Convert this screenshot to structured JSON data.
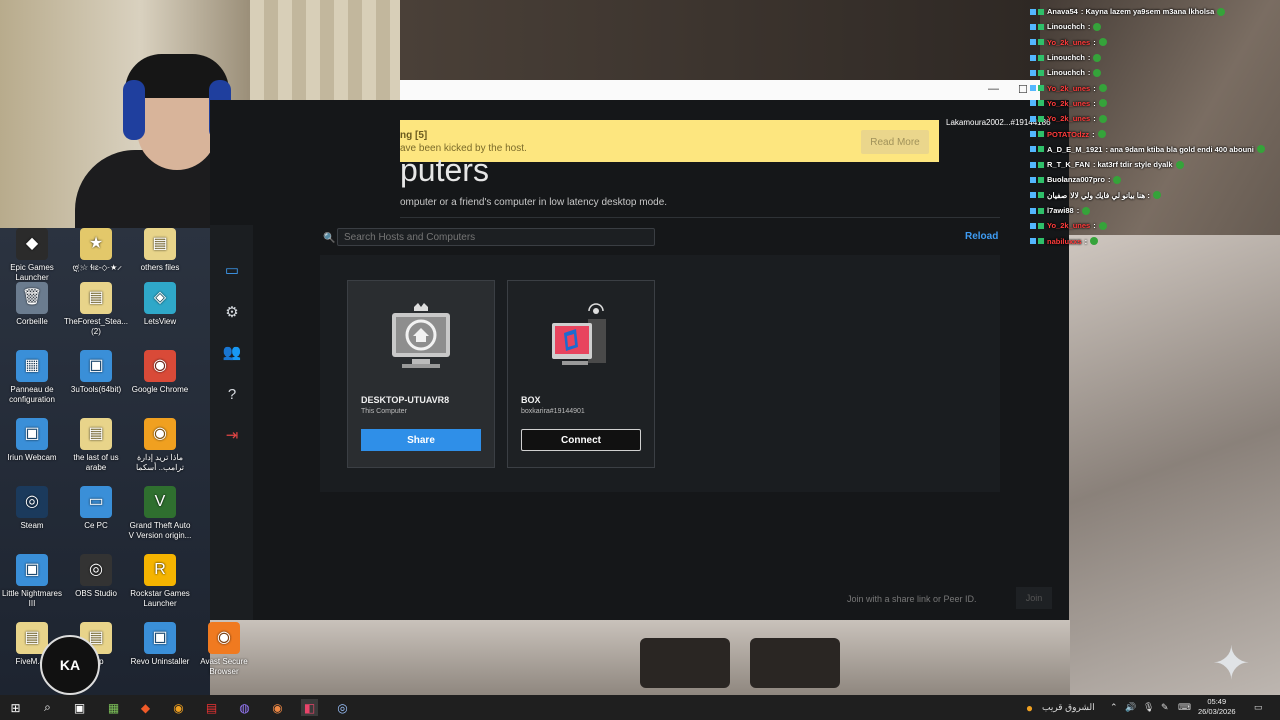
{
  "desktop": {
    "icons": [
      {
        "label": "Epic Games Launcher",
        "glyph": "◆",
        "color": "#2b2b2b"
      },
      {
        "label": "ღ҉ ☆ ɬıɛ-◇·★ ̷",
        "glyph": "★",
        "color": "#e3c86a"
      },
      {
        "label": "others files",
        "glyph": "▤",
        "color": "#e8d48a"
      },
      {
        "label": "Corbeille",
        "glyph": "🗑",
        "color": "#6b7c8f"
      },
      {
        "label": "TheForest_Stea... (2)",
        "glyph": "▤",
        "color": "#e8d48a"
      },
      {
        "label": "LetsView",
        "glyph": "◈",
        "color": "#2fa8c9"
      },
      {
        "label": "Panneau de configuration",
        "glyph": "▦",
        "color": "#3a8fd8"
      },
      {
        "label": "3uTools(64bit)",
        "glyph": "▣",
        "color": "#3a8fd8"
      },
      {
        "label": "Google Chrome",
        "glyph": "◉",
        "color": "#d94a38"
      },
      {
        "label": "Iriun Webcam",
        "glyph": "▣",
        "color": "#3a8fd8"
      },
      {
        "label": "the last of us arabe",
        "glyph": "▤",
        "color": "#e8d48a"
      },
      {
        "label": "ماذا تريد إدارة ترامب.. أسكما",
        "glyph": "◉",
        "color": "#f0a020"
      },
      {
        "label": "Steam",
        "glyph": "◎",
        "color": "#1b3a5c"
      },
      {
        "label": "Ce PC",
        "glyph": "▭",
        "color": "#3a8fd8"
      },
      {
        "label": "Grand Theft Auto V Version origin...",
        "glyph": "V",
        "color": "#2f6f2f"
      },
      {
        "label": "Little Nightmares III",
        "glyph": "▣",
        "color": "#3a8fd8"
      },
      {
        "label": "OBS Studio",
        "glyph": "◎",
        "color": "#333"
      },
      {
        "label": "Rockstar Games Launcher",
        "glyph": "R",
        "color": "#f5b400"
      },
      {
        "label": "FiveM.ap",
        "glyph": "▤",
        "color": "#e8d48a"
      },
      {
        "label": "y up",
        "glyph": "▤",
        "color": "#e8d48a"
      },
      {
        "label": "Revo Uninstaller",
        "glyph": "▣",
        "color": "#3a8fd8"
      },
      {
        "label": "Avast Secure Browser",
        "glyph": "◉",
        "color": "#f07a20"
      }
    ],
    "badge": "KA"
  },
  "app": {
    "banner": {
      "title": "ng [5]",
      "message": "ave been kicked by the host.",
      "read_more": "Read More"
    },
    "user_tag": "Lakamoura2002...#19144186",
    "page_title": "puters",
    "page_subtitle": "omputer or a friend's computer in low latency desktop mode.",
    "search_placeholder": "Search Hosts and Computers",
    "reload_label": "Reload",
    "cards": [
      {
        "name": "DESKTOP-UTUAVR8",
        "subtitle": "This Computer",
        "button": "Share"
      },
      {
        "name": "BOX",
        "subtitle": "boxkarira#19144901",
        "button": "Connect"
      }
    ],
    "join_label": "Join with a share link or Peer ID.",
    "join_button": "Join"
  },
  "chat": [
    {
      "user": "Anava54",
      "text": ": Kayna lazem ya9sem m3ana lkholsa",
      "color": "#e0e0e0"
    },
    {
      "user": "Linouchch",
      "text": ":",
      "color": "#e0e0e0"
    },
    {
      "user": "Yo_2k_unes",
      "text": ":",
      "color": "#ff3b3b"
    },
    {
      "user": "Linouchch",
      "text": ":",
      "color": "#e0e0e0"
    },
    {
      "user": "Linouchch",
      "text": ":",
      "color": "#e0e0e0"
    },
    {
      "user": "Yo_2k_unes",
      "text": ":",
      "color": "#ff3b3b"
    },
    {
      "user": "Yo_2k_unes",
      "text": ":",
      "color": "#ff3b3b"
    },
    {
      "user": "Yo_2k_unes",
      "text": ":",
      "color": "#ff3b3b"
    },
    {
      "user": "POTATOdzz",
      "text": ":",
      "color": "#ff3b3b"
    },
    {
      "user": "A_D_E_M_1921",
      "text": ": ana 9dam ktiba bla gold endi 400 abouni",
      "color": "#e0e0e0"
    },
    {
      "user": "R_T_K_FAN",
      "text": ": kat3rf tdir style dyalk",
      "color": "#e0e0e0"
    },
    {
      "user": "Buolanza007pro",
      "text": ":",
      "color": "#e0e0e0"
    },
    {
      "user": "صفيان",
      "text": "هنا بيانو لي فايك ولي لالا :",
      "color": "#e0e0e0"
    },
    {
      "user": "l7awi88",
      "text": ":",
      "color": "#e0e0e0"
    },
    {
      "user": "Yo_2k_unes",
      "text": ":",
      "color": "#ff3b3b"
    },
    {
      "user": "nabiluxxs",
      "text": ":",
      "color": "#ff3b3b"
    }
  ],
  "taskbar": {
    "weather": "الشروق قريب",
    "time": "05:49",
    "date": "26/03/2026"
  }
}
